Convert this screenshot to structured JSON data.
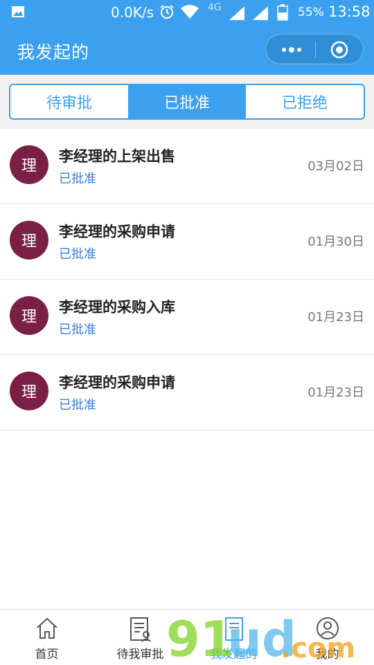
{
  "status_bar": {
    "speed": "0.0K/s",
    "network": "4G",
    "battery": "55%",
    "time": "13:58",
    "icons": [
      "image-icon",
      "alarm-icon",
      "wifi-icon",
      "signal-icon",
      "signal-icon",
      "battery-icon"
    ]
  },
  "nav": {
    "title": "我发起的",
    "capsule_icons": [
      "more-dots-icon",
      "target-icon"
    ]
  },
  "tabs": [
    {
      "label": "待审批",
      "active": false
    },
    {
      "label": "已批准",
      "active": true
    },
    {
      "label": "已拒绝",
      "active": false
    }
  ],
  "items": [
    {
      "avatar": "理",
      "title": "李经理的上架出售",
      "status": "已批准",
      "date": "03月02日"
    },
    {
      "avatar": "理",
      "title": "李经理的采购申请",
      "status": "已批准",
      "date": "01月30日"
    },
    {
      "avatar": "理",
      "title": "李经理的采购入库",
      "status": "已批准",
      "date": "01月23日"
    },
    {
      "avatar": "理",
      "title": "李经理的采购申请",
      "status": "已批准",
      "date": "01月23日"
    }
  ],
  "tabbar": [
    {
      "label": "首页",
      "icon": "home-icon"
    },
    {
      "label": "待我审批",
      "icon": "approval-icon"
    },
    {
      "label": "我发起的",
      "icon": "document-icon"
    },
    {
      "label": "我的",
      "icon": "user-icon"
    }
  ],
  "colors": {
    "primary": "#3aa0ef",
    "avatar": "#7b1f45",
    "status": "#3a7bd5"
  }
}
